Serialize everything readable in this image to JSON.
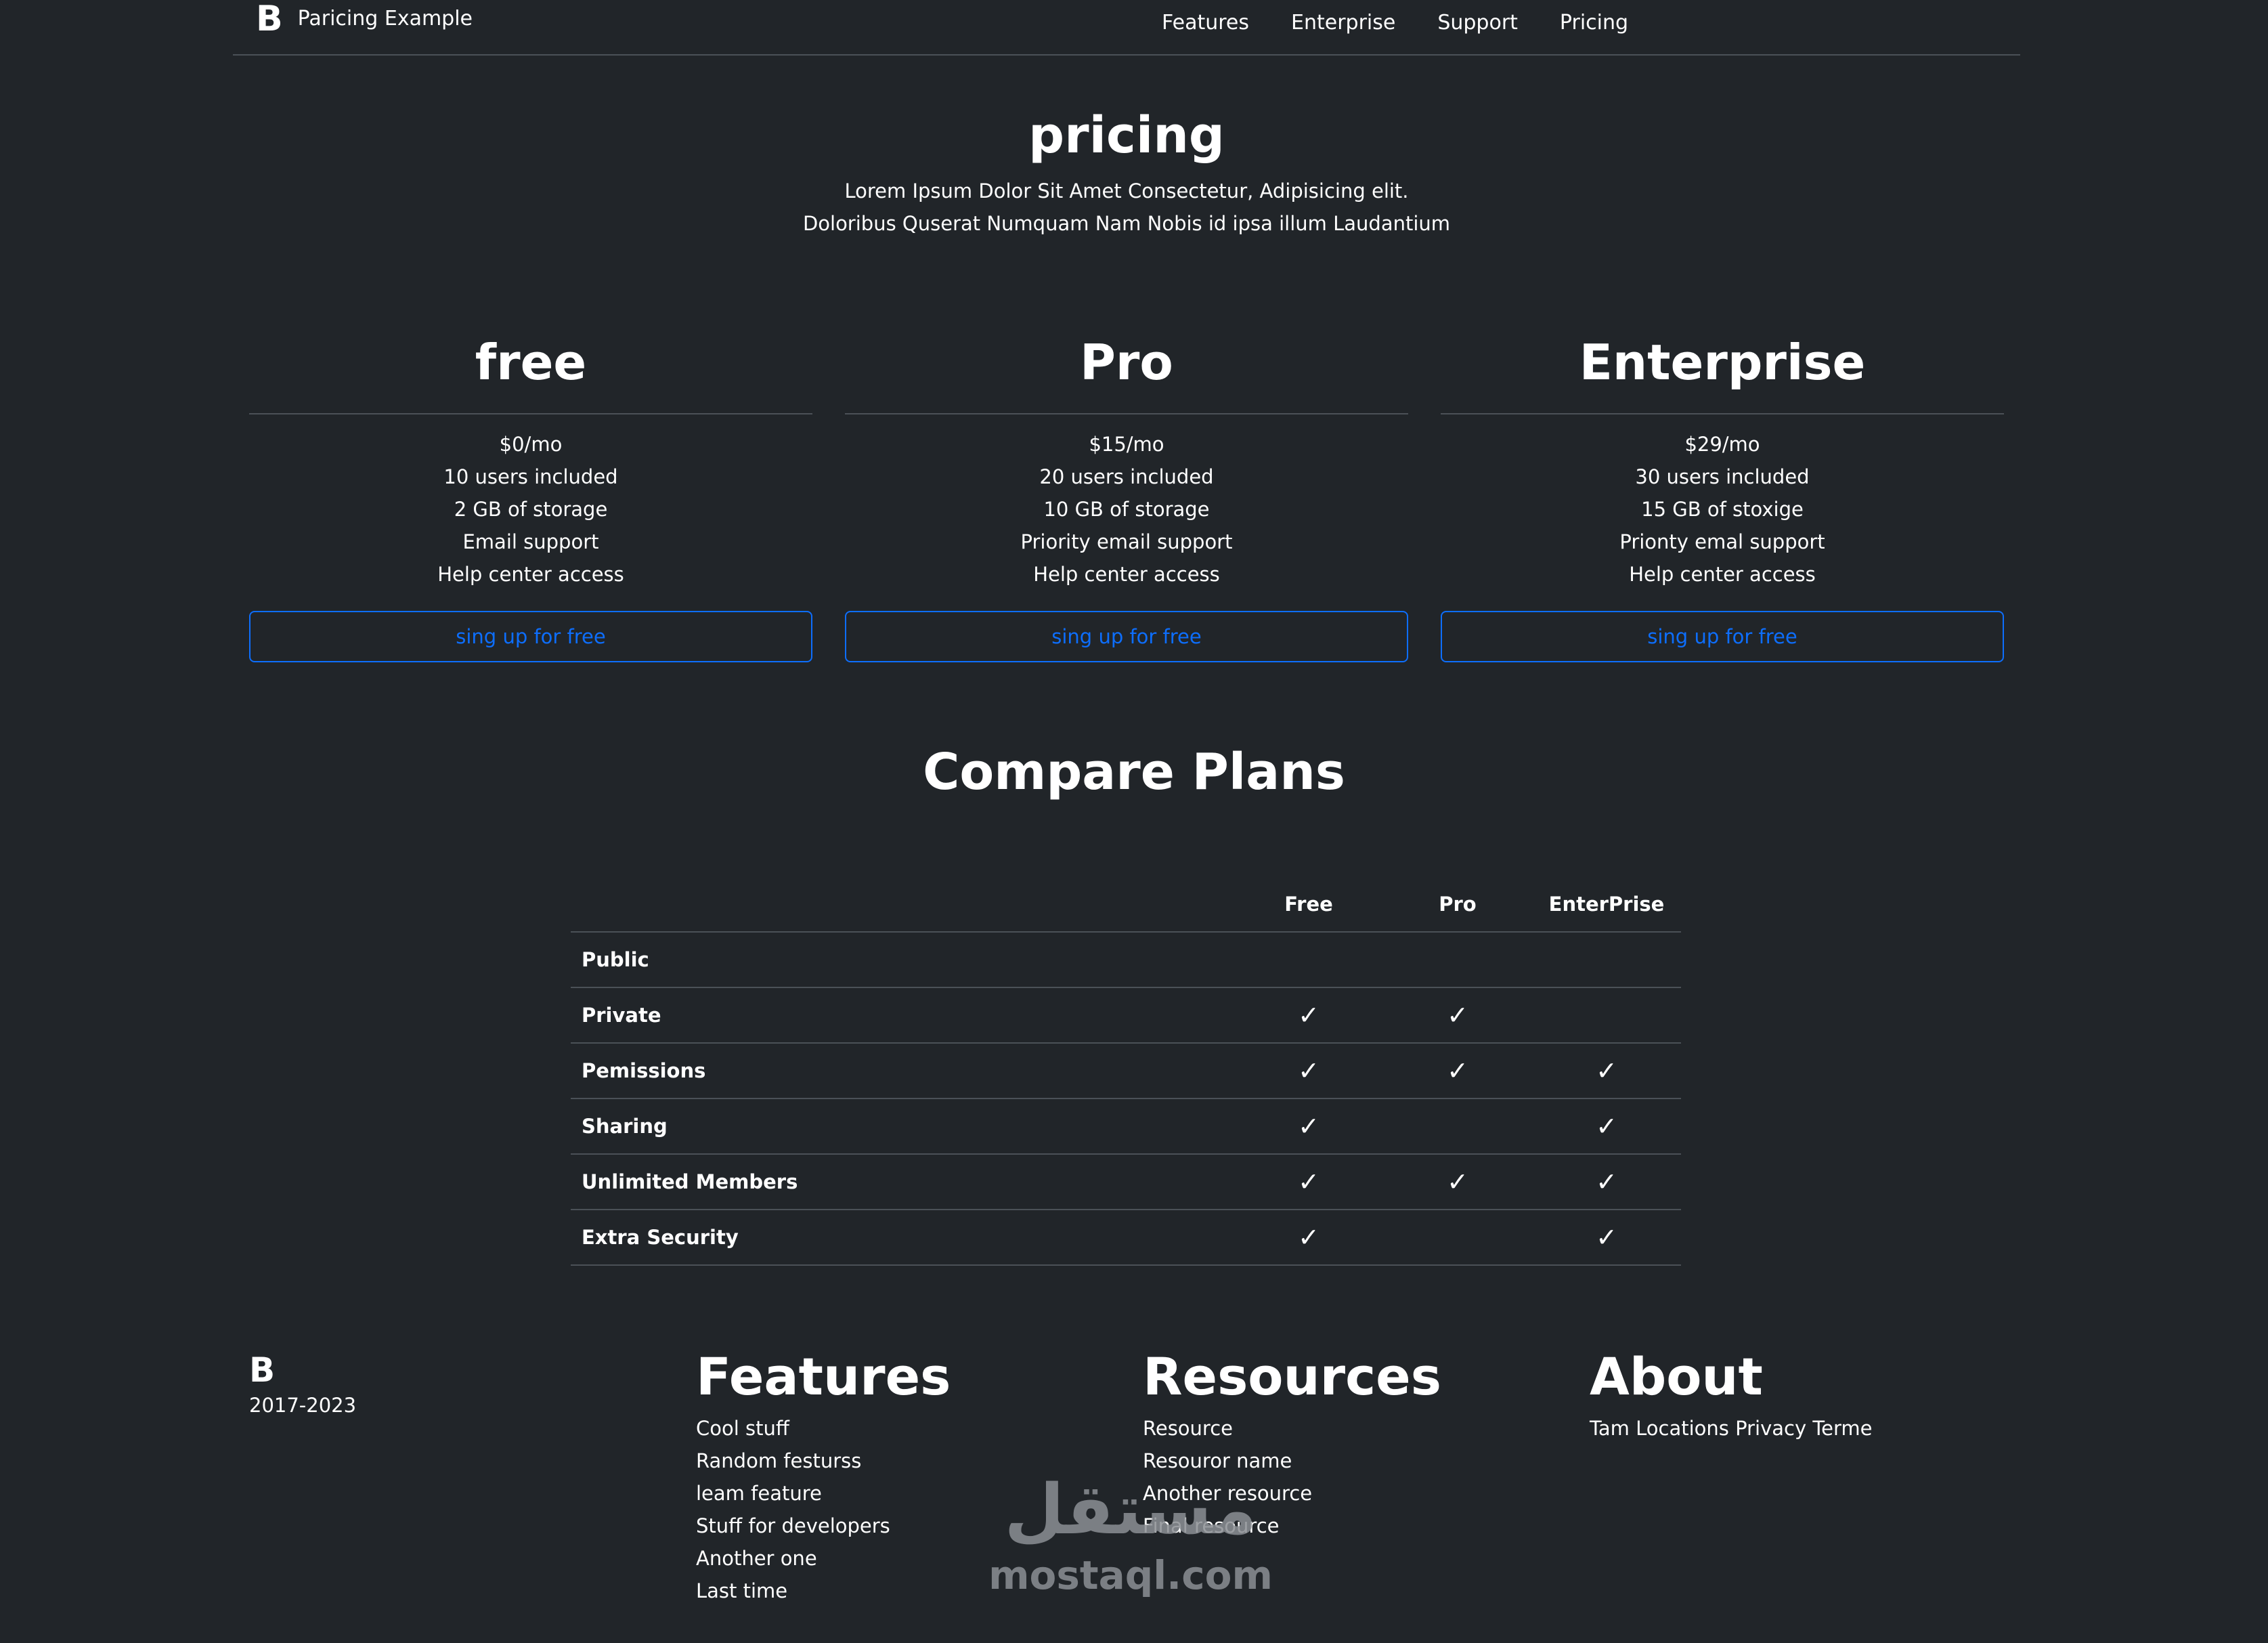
{
  "header": {
    "logo": "B",
    "brand": "Paricing Example",
    "nav": [
      "Features",
      "Enterprise",
      "Support",
      "Pricing"
    ]
  },
  "hero": {
    "title": "pricing",
    "line1": "Lorem Ipsum Dolor Sit Amet Consectetur, Adipisicing elit.",
    "line2": "Doloribus Quserat Numquam Nam Nobis id ipsa illum Laudantium"
  },
  "plans": [
    {
      "name": "free",
      "features": [
        "$0/mo",
        "10 users included",
        "2 GB of storage",
        "Email support",
        "Help center access"
      ],
      "button": "sing up for free"
    },
    {
      "name": "Pro",
      "features": [
        "$15/mo",
        "20 users included",
        "10 GB of storage",
        "Priority email support",
        "Help center access"
      ],
      "button": "sing up for free"
    },
    {
      "name": "Enterprise",
      "features": [
        "$29/mo",
        "30 users included",
        "15 GB of stoxige",
        "Prionty emal support",
        "Help center access"
      ],
      "button": "sing up for free"
    }
  ],
  "compare": {
    "title": "Compare Plans",
    "columns": [
      "Free",
      "Pro",
      "EnterPrise"
    ],
    "check": "✓",
    "rows": [
      {
        "label": "Public",
        "checks": [
          false,
          false,
          false
        ]
      },
      {
        "label": "Private",
        "checks": [
          true,
          true,
          false
        ]
      },
      {
        "label": "Pemissions",
        "checks": [
          true,
          true,
          true
        ]
      },
      {
        "label": "Sharing",
        "checks": [
          true,
          false,
          true
        ]
      },
      {
        "label": "Unlimited Members",
        "checks": [
          true,
          true,
          true
        ]
      },
      {
        "label": "Extra Security",
        "checks": [
          true,
          false,
          true
        ]
      }
    ]
  },
  "footer": {
    "logo": "B",
    "copyright": "2017-2023",
    "features_title": "Features",
    "features": [
      "Cool stuff",
      "Random festurss",
      "leam feature",
      "Stuff for developers",
      "Another one",
      "Last time"
    ],
    "resources_title": "Resources",
    "resources": [
      "Resource",
      "Resouror name",
      "Another resource",
      "Final resource"
    ],
    "about_title": "About",
    "about": [
      "Tam Locations Privacy Terme"
    ]
  },
  "watermark": {
    "arabic": "مستقل",
    "latin": "mostaql.com"
  }
}
